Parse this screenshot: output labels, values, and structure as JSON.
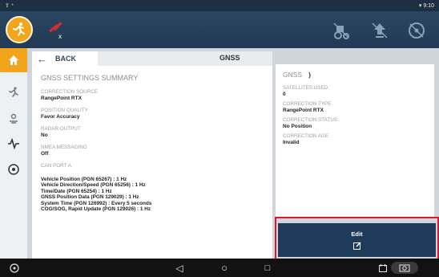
{
  "status_bar": {
    "left_icons": "⇪ ⁺",
    "time": "9:10"
  },
  "top_bar": {
    "gps_status": "x",
    "icons": [
      "tractor-icon",
      "upload-icon",
      "steering-wheel-icon"
    ]
  },
  "sidebar": {
    "items": [
      "home-icon",
      "guidance-icon",
      "gnss-icon",
      "signal-icon",
      "settings-icon"
    ]
  },
  "header": {
    "back_label": "BACK",
    "title": "GNSS"
  },
  "summary": {
    "title": "GNSS SETTINGS SUMMARY",
    "fields": [
      {
        "label": "CORRECTION SOURCE",
        "value": "RangePoint RTX"
      },
      {
        "label": "POSITION QUALITY",
        "value": "Favor Accuracy"
      },
      {
        "label": "RADAR OUTPUT",
        "value": "No"
      },
      {
        "label": "NMEA MESSAGING",
        "value": "Off"
      }
    ],
    "can_label": "CAN PORT A",
    "can_lines": [
      "Vehicle Position (PGN 65267) : 1 Hz",
      "Vehicle Direction/Speed (PGN 65256) : 1 Hz",
      "Time/Date (PGN 65254) : 1 Hz",
      "GNSS Position Data (PGN 129029) : 1 Hz",
      "System Time (PGN 126992) : Every 5 seconds",
      "COG/SOG, Rapid Update (PGN 129026) : 1 Hz"
    ]
  },
  "gnss_status": {
    "title": "GNSS",
    "title_suffix": ")",
    "fields": [
      {
        "label": "SATELLITES USED:",
        "value": "0"
      },
      {
        "label": "CORRECTION TYPE",
        "value": "RangePoint RTX"
      },
      {
        "label": "CORRECTION STATUS:",
        "value": "No Position"
      },
      {
        "label": "CORRECTION AGE",
        "value": "Invalid"
      }
    ]
  },
  "edit_button": {
    "label": "Edit"
  },
  "nav_bar": {
    "back": "◁",
    "home": "○",
    "recents": "□"
  },
  "colors": {
    "accent": "#f2a51a",
    "primary": "#1f3b5b",
    "highlight": "#d81b2b"
  }
}
